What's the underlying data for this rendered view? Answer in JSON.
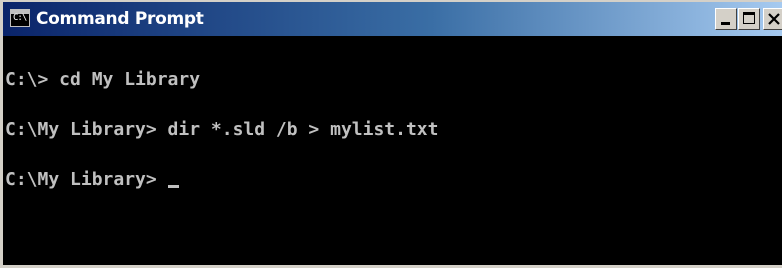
{
  "window": {
    "title": "Command Prompt",
    "app_icon": "console-app-icon",
    "app_icon_text": "C:\\",
    "controls": {
      "minimize_icon": "minimize-icon",
      "maximize_icon": "maximize-icon",
      "close_icon": "close-icon"
    },
    "colors": {
      "titlebar_start": "#0a246a",
      "titlebar_end": "#a6caf0",
      "console_background": "#000000",
      "console_text": "#c0c0c0",
      "frame": "#d4d0c8"
    }
  },
  "console": {
    "lines": [
      "C:\\> cd My Library",
      "C:\\My Library> dir *.sld /b > mylist.txt",
      "C:\\My Library> "
    ],
    "cursor_style": "underscore"
  }
}
